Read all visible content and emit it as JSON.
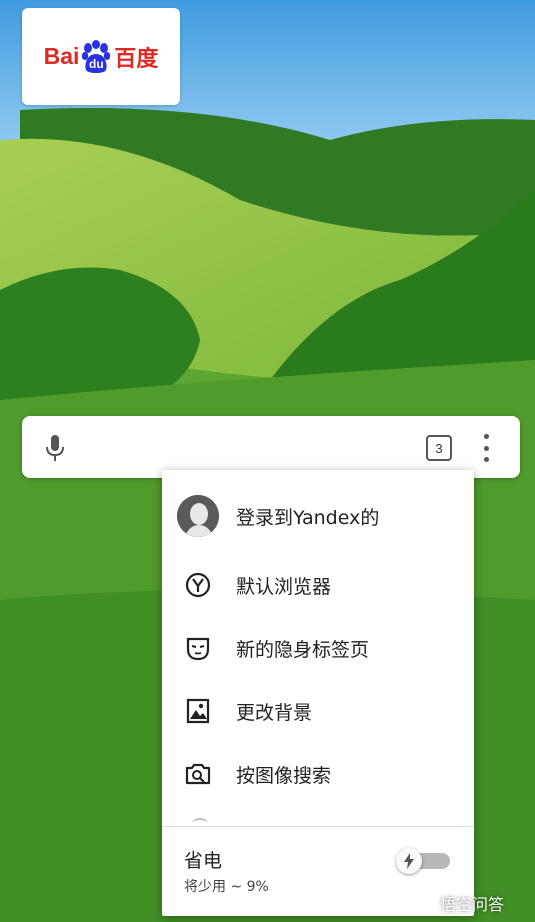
{
  "logo": {
    "latin_left": "Bai",
    "paw_text": "du",
    "chinese": "百度"
  },
  "searchbar": {
    "tab_count": "3"
  },
  "menu": {
    "items": [
      {
        "label": "登录到Yandex的",
        "icon": "user-avatar-icon"
      },
      {
        "label": "默认浏览器",
        "icon": "yandex-y-icon"
      },
      {
        "label": "新的隐身标签页",
        "icon": "incognito-mask-icon"
      },
      {
        "label": "更改背景",
        "icon": "image-icon"
      },
      {
        "label": "按图像搜索",
        "icon": "camera-search-icon"
      }
    ],
    "power_saving": {
      "title": "省电",
      "subtitle": "将少用 ~ 9%",
      "enabled": false
    }
  },
  "watermark": {
    "text": "悟空问答"
  }
}
